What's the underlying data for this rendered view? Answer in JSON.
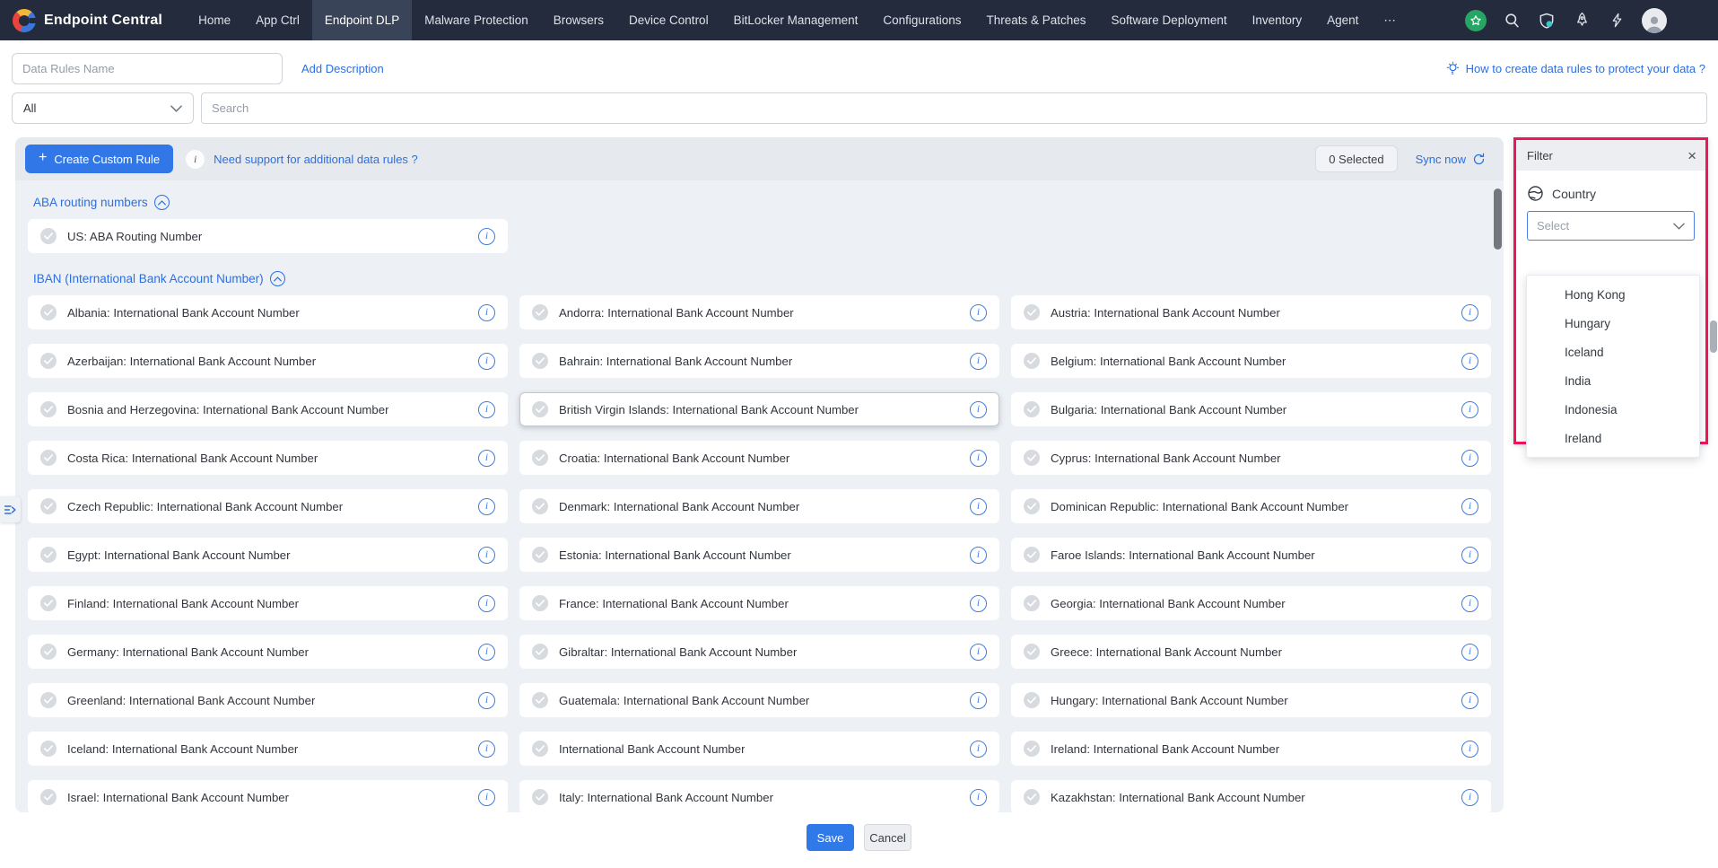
{
  "nav": {
    "brand": "Endpoint Central",
    "items": [
      {
        "label": "Home",
        "active": false
      },
      {
        "label": "App Ctrl",
        "active": false
      },
      {
        "label": "Endpoint DLP",
        "active": true
      },
      {
        "label": "Malware Protection",
        "active": false
      },
      {
        "label": "Browsers",
        "active": false
      },
      {
        "label": "Device Control",
        "active": false
      },
      {
        "label": "BitLocker Management",
        "active": false
      },
      {
        "label": "Configurations",
        "active": false
      },
      {
        "label": "Threats & Patches",
        "active": false
      },
      {
        "label": "Software Deployment",
        "active": false
      },
      {
        "label": "Inventory",
        "active": false
      },
      {
        "label": "Agent",
        "active": false
      },
      {
        "label": "⋯",
        "active": false
      }
    ],
    "right_icons": [
      "star-badge-icon",
      "search-icon",
      "shield-privacy-icon",
      "rocket-icon",
      "lightning-icon",
      "avatar",
      "apps-grid-icon"
    ]
  },
  "toolbar": {
    "name_placeholder": "Data Rules Name",
    "add_description_label": "Add Description",
    "help_link_label": "How to create data rules to protect your data ?",
    "filter_selected_value": "All",
    "search_placeholder": "Search"
  },
  "list_header": {
    "create_plus": "+",
    "create_label": "Create Custom Rule",
    "info_glyph": "i",
    "support_link_label": "Need support for additional data rules ?",
    "selected_badge": "0 Selected",
    "sync_label": "Sync now"
  },
  "sections": [
    {
      "title": "ABA routing numbers",
      "rules": [
        "US: ABA Routing Number"
      ]
    },
    {
      "title": "IBAN (International Bank Account Number)",
      "rules": [
        "Albania: International Bank Account Number",
        "Andorra: International Bank Account Number",
        "Austria: International Bank Account Number",
        "Azerbaijan: International Bank Account Number",
        "Bahrain: International Bank Account Number",
        "Belgium: International Bank Account Number",
        "Bosnia and Herzegovina: International Bank Account Number",
        "British Virgin Islands: International Bank Account Number",
        "Bulgaria: International Bank Account Number",
        "Costa Rica: International Bank Account Number",
        "Croatia: International Bank Account Number",
        "Cyprus: International Bank Account Number",
        "Czech Republic: International Bank Account Number",
        "Denmark: International Bank Account Number",
        "Dominican Republic: International Bank Account Number",
        "Egypt: International Bank Account Number",
        "Estonia: International Bank Account Number",
        "Faroe Islands: International Bank Account Number",
        "Finland: International Bank Account Number",
        "France: International Bank Account Number",
        "Georgia: International Bank Account Number",
        "Germany: International Bank Account Number",
        "Gibraltar: International Bank Account Number",
        "Greece: International Bank Account Number",
        "Greenland: International Bank Account Number",
        "Guatemala: International Bank Account Number",
        "Hungary: International Bank Account Number",
        "Iceland: International Bank Account Number",
        "International Bank Account Number",
        "Ireland: International Bank Account Number",
        "Israel: International Bank Account Number",
        "Italy: International Bank Account Number",
        "Kazakhstan: International Bank Account Number"
      ]
    }
  ],
  "highlighted_rule": "British Virgin Islands: International Bank Account Number",
  "filter_panel": {
    "title": "Filter",
    "close_glyph": "×",
    "field_label": "Country",
    "select_placeholder": "Select",
    "options": [
      "Hong Kong",
      "Hungary",
      "Iceland",
      "India",
      "Indonesia",
      "Ireland"
    ]
  },
  "footer": {
    "save_label": "Save",
    "cancel_label": "Cancel"
  },
  "colors": {
    "nav_bg": "#232b3d",
    "nav_active_bg": "#3a4459",
    "accent_blue": "#2c6fe0",
    "button_blue": "#3277e8",
    "annotation_pink": "#f0145a",
    "panel_bg": "#edf0f4",
    "strip_bg": "#e6e9ee",
    "badge_green": "#27a565",
    "teal_dot": "#3ec6cd"
  }
}
